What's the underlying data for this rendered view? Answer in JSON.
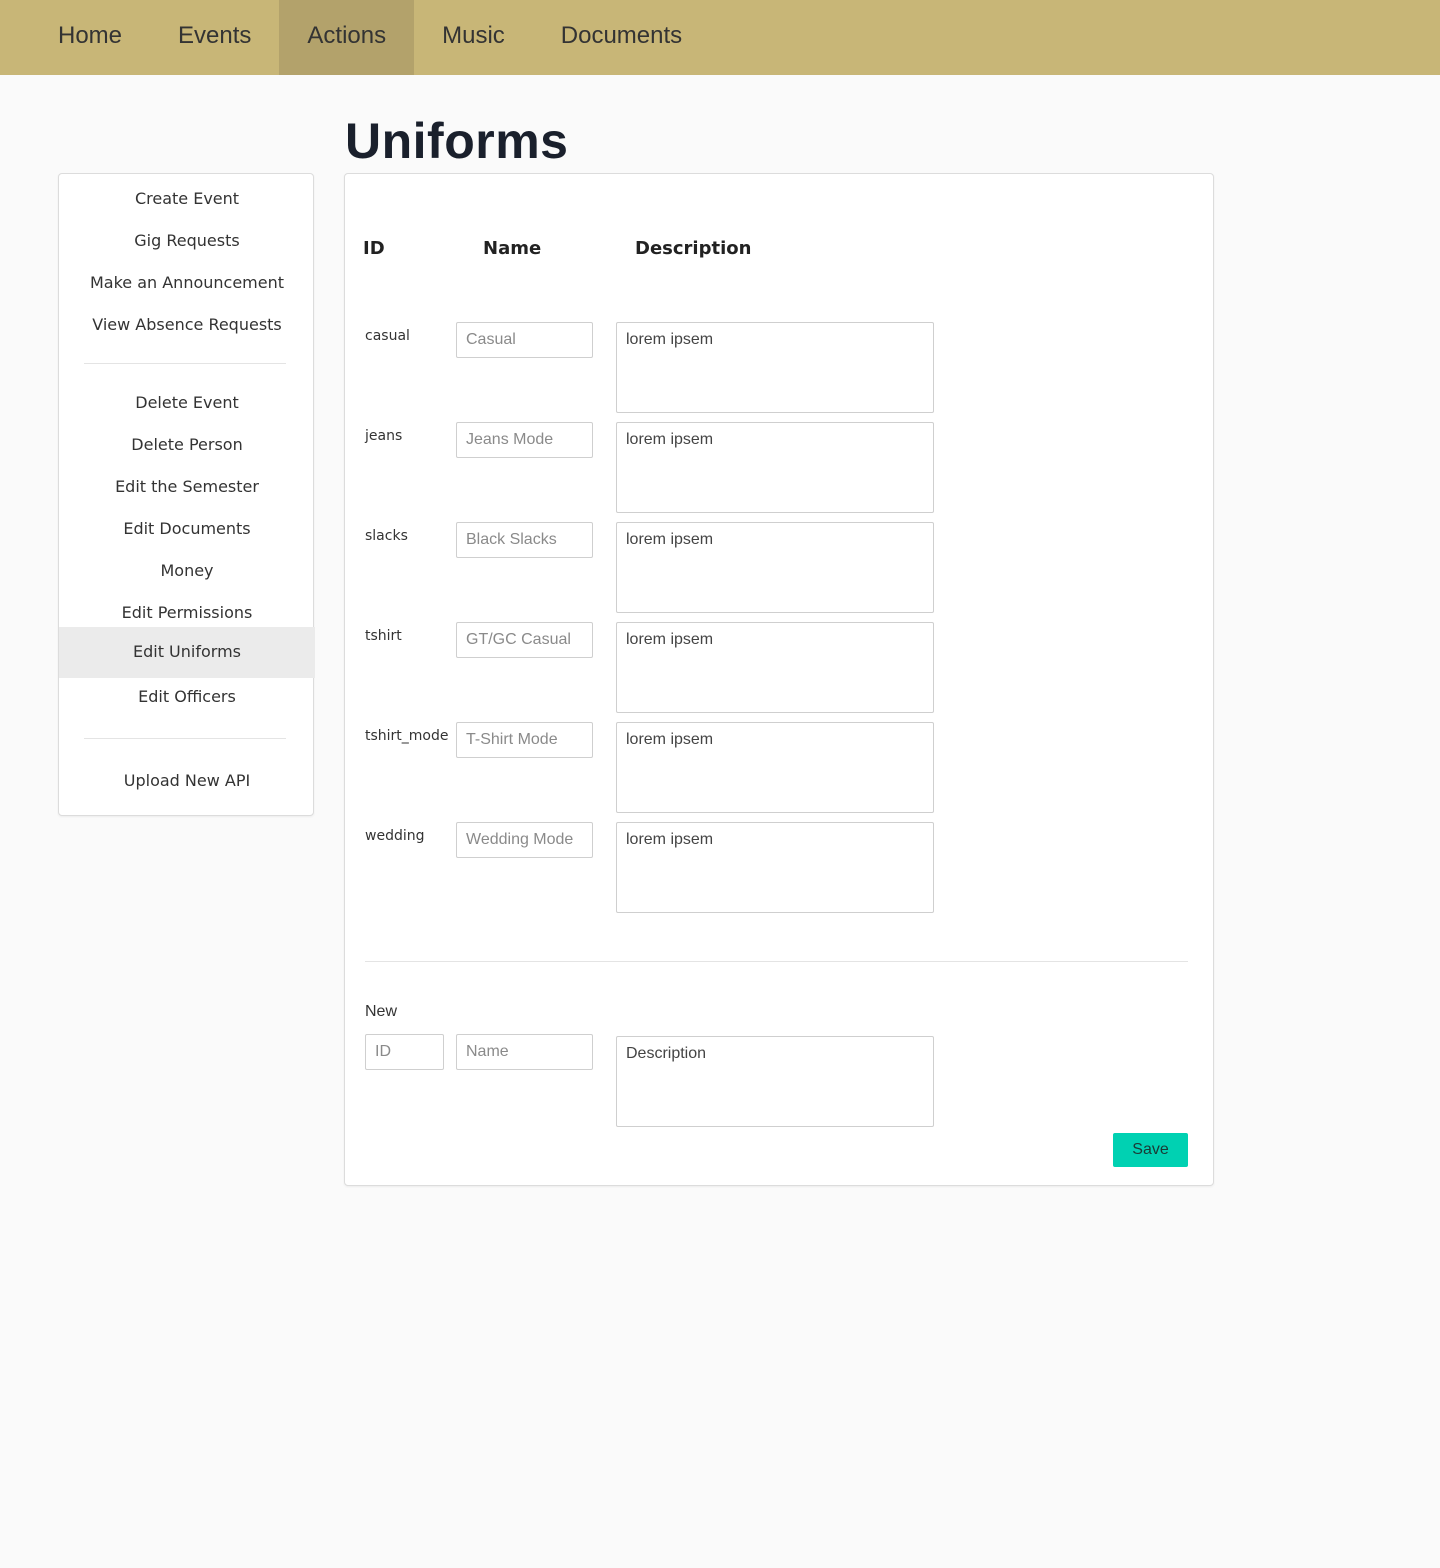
{
  "nav": {
    "items": [
      {
        "label": "Home",
        "active": false
      },
      {
        "label": "Events",
        "active": false
      },
      {
        "label": "Actions",
        "active": true
      },
      {
        "label": "Music",
        "active": false
      },
      {
        "label": "Documents",
        "active": false
      }
    ]
  },
  "page": {
    "title": "Uniforms"
  },
  "sidebar": {
    "group1": [
      "Create Event",
      "Gig Requests",
      "Make an Announcement",
      "View Absence Requests"
    ],
    "group2": [
      "Delete Event",
      "Delete Person",
      "Edit the Semester",
      "Edit Documents",
      "Money",
      "Edit Permissions",
      "Edit Uniforms",
      "Edit Officers"
    ],
    "group3": [
      "Upload New API"
    ],
    "active": "Edit Uniforms"
  },
  "table": {
    "headers": {
      "id": "ID",
      "name": "Name",
      "description": "Description"
    },
    "rows": [
      {
        "id": "casual",
        "name": "Casual",
        "description": "lorem ipsem"
      },
      {
        "id": "jeans",
        "name": "Jeans Mode",
        "description": "lorem ipsem"
      },
      {
        "id": "slacks",
        "name": "Black Slacks",
        "description": "lorem ipsem"
      },
      {
        "id": "tshirt",
        "name": "GT/GC Casual",
        "description": "lorem ipsem"
      },
      {
        "id": "tshirt_mode",
        "name": "T-Shirt Mode",
        "description": "lorem ipsem"
      },
      {
        "id": "wedding",
        "name": "Wedding Mode",
        "description": "lorem ipsem"
      }
    ]
  },
  "new_entry": {
    "label": "New",
    "id_placeholder": "ID",
    "name_placeholder": "Name",
    "description_placeholder": "Description"
  },
  "save_label": "Save",
  "colors": {
    "nav_bg": "#c8b677",
    "nav_active": "#b3a26b",
    "save_button": "#00d1b2"
  }
}
